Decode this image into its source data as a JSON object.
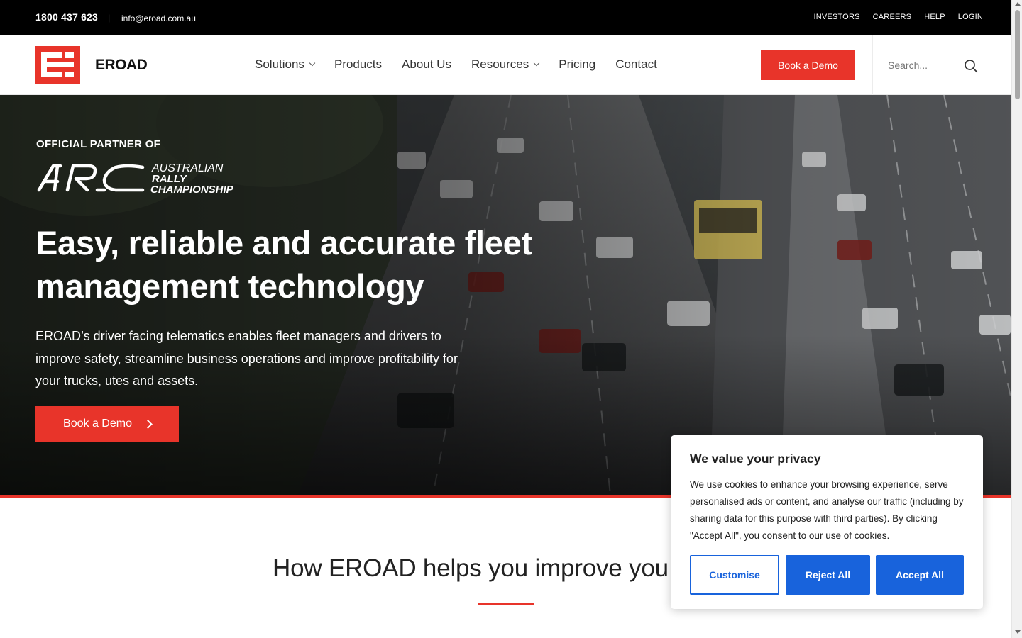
{
  "topbar": {
    "phone": "1800 437 623",
    "separator": "|",
    "email": "info@eroad.com.au",
    "links": [
      "INVESTORS",
      "CAREERS",
      "HELP",
      "LOGIN"
    ]
  },
  "header": {
    "brand": "EROAD",
    "nav": [
      {
        "label": "Solutions",
        "dropdown": true
      },
      {
        "label": "Products",
        "dropdown": false
      },
      {
        "label": "About Us",
        "dropdown": false
      },
      {
        "label": "Resources",
        "dropdown": true
      },
      {
        "label": "Pricing",
        "dropdown": false
      },
      {
        "label": "Contact",
        "dropdown": false
      }
    ],
    "cta_label": "Book a Demo",
    "search_placeholder": "Search..."
  },
  "hero": {
    "partner_label": "OFFICIAL PARTNER OF",
    "partner_logo": {
      "mark": "ARC",
      "line1": "AUSTRALIAN",
      "line2": "RALLY",
      "line3": "CHAMPIONSHIP"
    },
    "headline": "Easy, reliable and accurate fleet management technology",
    "description": "EROAD’s driver facing telematics enables fleet managers and drivers to improve safety, streamline business operations and improve profitability for your trucks, utes and assets.",
    "cta_label": "Book a Demo"
  },
  "section": {
    "title": "How EROAD helps you improve you"
  },
  "cookie": {
    "title": "We value your privacy",
    "body": "We use cookies to enhance your browsing experience, serve personalised ads or content, and analyse our traffic (including by sharing data for this purpose with third parties). By clicking \"Accept All\", you consent to our use of cookies.",
    "customise_label": "Customise",
    "reject_label": "Reject All",
    "accept_label": "Accept All"
  },
  "colors": {
    "brand_red": "#e8342a",
    "cookie_blue": "#1863dc",
    "topbar_bg": "#000000"
  }
}
